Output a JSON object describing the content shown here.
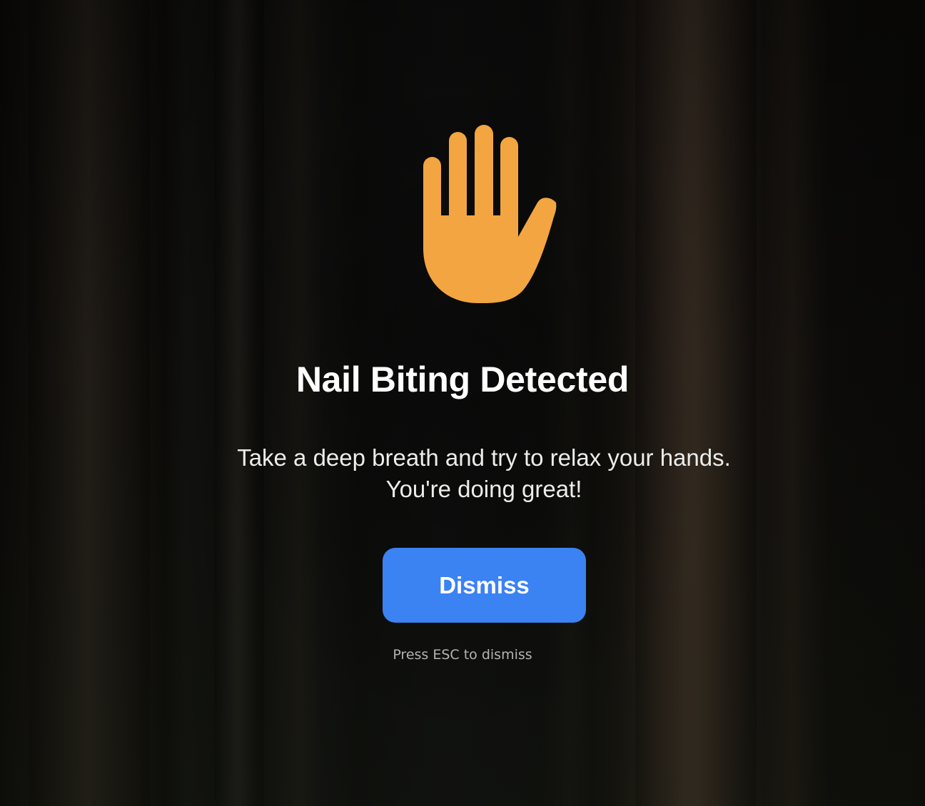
{
  "alert": {
    "icon": "raised-hand-icon",
    "icon_color": "#F2A541",
    "title": "Nail Biting Detected",
    "message_line1": "Take a deep breath and try to relax your hands.",
    "message_line2": "You're doing great!",
    "dismiss_label": "Dismiss",
    "dismiss_color": "#3B82F2",
    "hint": "Press ESC to dismiss"
  }
}
